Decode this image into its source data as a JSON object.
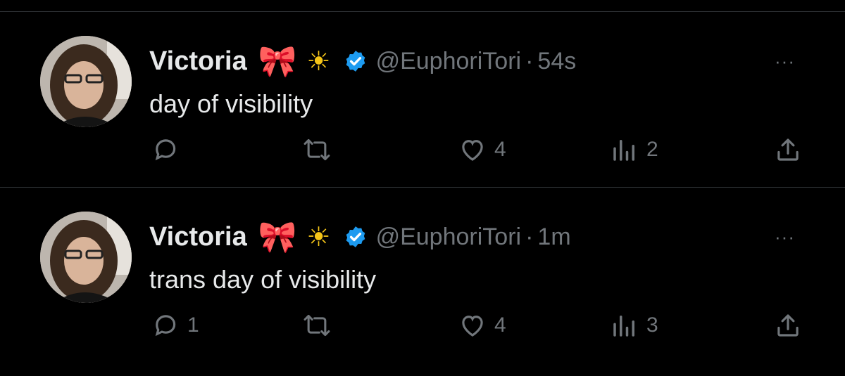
{
  "colors": {
    "background": "#000000",
    "text": "#e7e9ea",
    "secondary": "#71767b",
    "verified": "#1d9bf0",
    "divider": "#2f3336"
  },
  "tweets": [
    {
      "author": {
        "name": "Victoria",
        "emoji_1": "🎀",
        "emoji_2": "☀",
        "handle": "@EuphoriTori",
        "verified": true,
        "avatar_icon": "avatar"
      },
      "separator": "·",
      "time": "54s",
      "text": "day of visibility",
      "more": "···",
      "actions": {
        "reply": "",
        "retweet": "",
        "like": "4",
        "views": "2"
      }
    },
    {
      "author": {
        "name": "Victoria",
        "emoji_1": "🎀",
        "emoji_2": "☀",
        "handle": "@EuphoriTori",
        "verified": true,
        "avatar_icon": "avatar"
      },
      "separator": "·",
      "time": "1m",
      "text": "trans day of visibility",
      "more": "···",
      "actions": {
        "reply": "1",
        "retweet": "",
        "like": "4",
        "views": "3"
      }
    }
  ]
}
